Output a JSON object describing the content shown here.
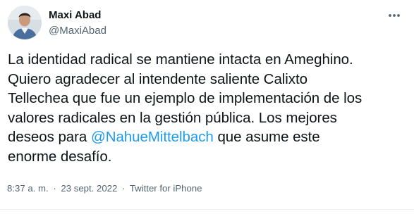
{
  "author": {
    "display_name": "Maxi Abad",
    "handle": "@MaxiAbad"
  },
  "tweet": {
    "line1": "La identidad radical se mantiene intacta en Ameghino.",
    "line2": "Quiero agradecer al intendente saliente Calixto",
    "line3": "Tellechea que fue un ejemplo de implementación de los",
    "line4": "valores radicales en la gestión pública. Los mejores",
    "line5_before": "deseos para ",
    "mention": "@NahueMittelbach",
    "line5_after": " que asume este",
    "line6": "enorme desafío."
  },
  "meta": {
    "time": "8:37 a. m.",
    "separator": "·",
    "date": "23 sept. 2022",
    "source": "Twitter for iPhone"
  },
  "icons": {
    "avatar": "profile-photo",
    "more": "ellipsis-icon"
  },
  "colors": {
    "text": "#0f1419",
    "secondary": "#536471",
    "link": "#1d9bf0"
  }
}
